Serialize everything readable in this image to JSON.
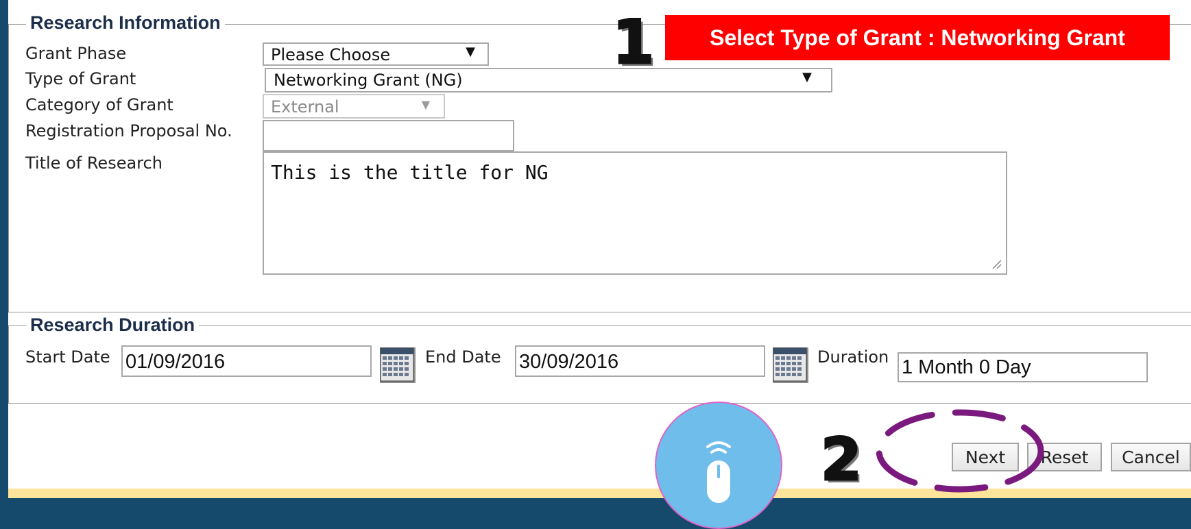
{
  "research_information": {
    "legend": "Research Information",
    "grant_phase": {
      "label": "Grant Phase",
      "value": "Please Choose"
    },
    "type_of_grant": {
      "label": "Type of Grant",
      "value": "Networking Grant (NG)"
    },
    "category_of_grant": {
      "label": "Category of Grant",
      "value": "External"
    },
    "registration_proposal_no": {
      "label": "Registration Proposal No.",
      "value": ""
    },
    "title_of_research": {
      "label": "Title of Research",
      "value": "This is the title for NG"
    }
  },
  "research_duration": {
    "legend": "Research Duration",
    "start_date": {
      "label": "Start Date",
      "value": "01/09/2016"
    },
    "end_date": {
      "label": "End Date",
      "value": "30/09/2016"
    },
    "duration": {
      "label": "Duration",
      "value": "1 Month 0 Day"
    }
  },
  "actions": {
    "next": "Next",
    "reset": "Reset",
    "cancel": "Cancel"
  },
  "annotations": {
    "step1_number": "1",
    "step1_banner": "Select Type of Grant : Networking Grant",
    "step2_number": "2",
    "banner_color": "#ff0000",
    "highlight_ring_color": "#7b1a7e",
    "mouse_icon": "mouse-click-icon"
  },
  "arrow_glyph": "▼"
}
